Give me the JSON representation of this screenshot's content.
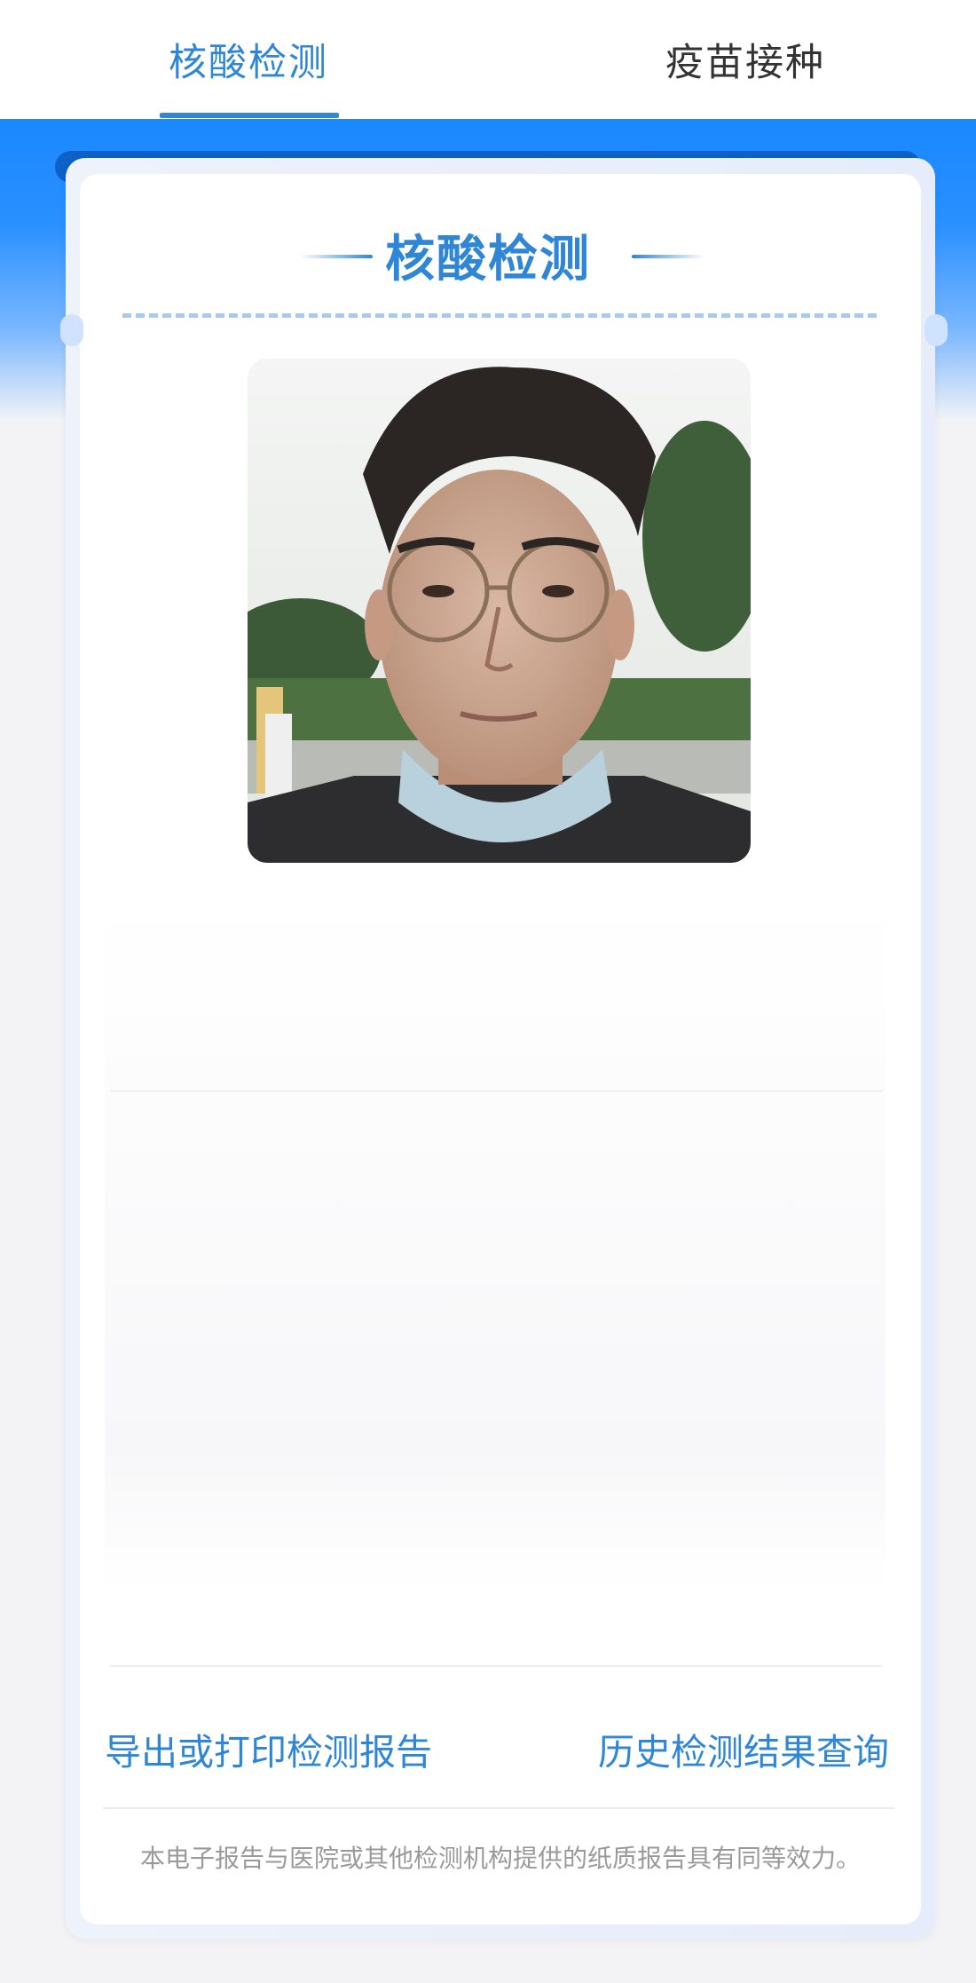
{
  "tabs": [
    {
      "label": "核酸检测",
      "active": true
    },
    {
      "label": "疫苗接种",
      "active": false
    }
  ],
  "card": {
    "title": "核酸检测",
    "photo": {
      "name": "user-photo"
    }
  },
  "actions": {
    "export_label": "导出或打印检测报告",
    "history_label": "历史检测结果查询"
  },
  "disclaimer": "本电子报告与医院或其他检测机构提供的纸质报告具有同等效力。",
  "colors": {
    "accent": "#2f86d6",
    "header_blue": "#1a88ff",
    "tab_inactive": "#333333",
    "muted_text": "#9a9a9a"
  }
}
